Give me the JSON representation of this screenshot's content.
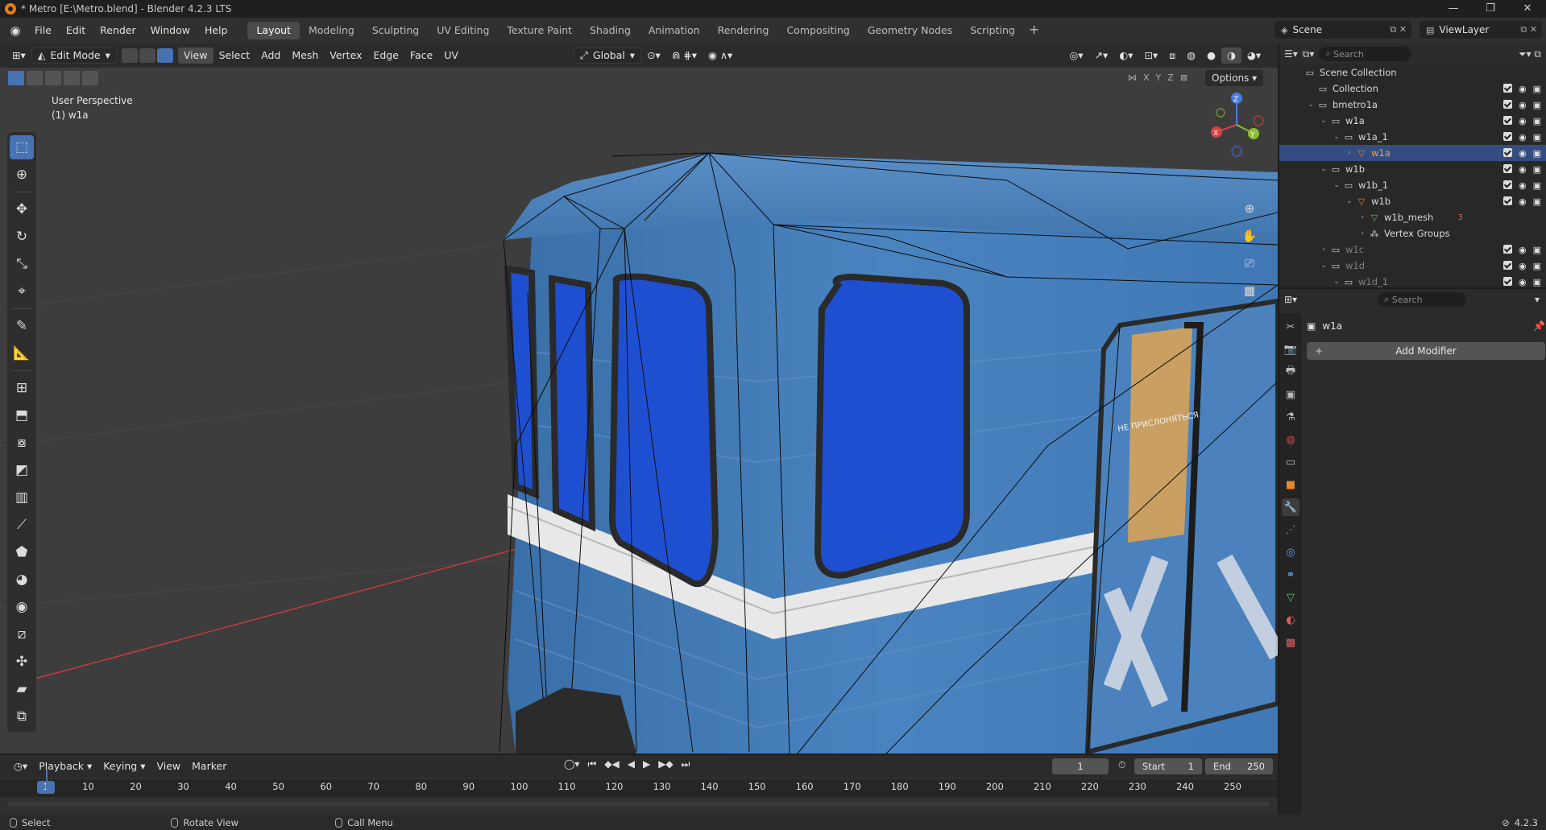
{
  "window": {
    "title": "* Metro [E:\\Metro.blend] - Blender 4.2.3 LTS",
    "controls": [
      "—",
      "❐",
      "✕"
    ]
  },
  "menu": [
    "File",
    "Edit",
    "Render",
    "Window",
    "Help"
  ],
  "workspaces": [
    "Layout",
    "Modeling",
    "Sculpting",
    "UV Editing",
    "Texture Paint",
    "Shading",
    "Animation",
    "Rendering",
    "Compositing",
    "Geometry Nodes",
    "Scripting"
  ],
  "active_workspace": "Layout",
  "scene": "Scene",
  "view_layer": "ViewLayer",
  "viewport": {
    "mode": "Edit Mode",
    "header_menus": [
      "View",
      "Select",
      "Add",
      "Mesh",
      "Vertex",
      "Edge",
      "Face",
      "UV"
    ],
    "orientation": "Global",
    "options": "Options",
    "axis_toggles": [
      "X",
      "Y",
      "Z"
    ],
    "view_name": "User Perspective",
    "object_label": "(1) w1a",
    "gizmo": {
      "x": "X",
      "y": "Y",
      "z": "Z"
    },
    "car_text": "НЕ ПРИСЛОНЯТЬСЯ"
  },
  "outliner": {
    "search_placeholder": "Search",
    "rows": [
      {
        "label": "Scene Collection",
        "indent": 0,
        "icon": "collection",
        "ctrls": false
      },
      {
        "label": "Collection",
        "indent": 1,
        "icon": "collection",
        "ctrls": true
      },
      {
        "label": "bmetro1a",
        "indent": 1,
        "icon": "collection",
        "ctrls": true,
        "twist": "⌄"
      },
      {
        "label": "w1a",
        "indent": 2,
        "icon": "collection",
        "ctrls": true,
        "twist": "⌄"
      },
      {
        "label": "w1a_1",
        "indent": 3,
        "icon": "collection",
        "ctrls": true,
        "twist": "⌄"
      },
      {
        "label": "w1a",
        "indent": 4,
        "icon": "mesh-object",
        "ctrls": true,
        "twist": "›",
        "selected": true
      },
      {
        "label": "w1b",
        "indent": 2,
        "icon": "collection",
        "ctrls": true,
        "twist": "⌄"
      },
      {
        "label": "w1b_1",
        "indent": 3,
        "icon": "collection",
        "ctrls": true,
        "twist": "⌄"
      },
      {
        "label": "w1b",
        "indent": 4,
        "icon": "mesh-object",
        "ctrls": true,
        "twist": "⌄"
      },
      {
        "label": "w1b_mesh",
        "indent": 5,
        "icon": "mesh-data",
        "ctrls": false,
        "twist": "›",
        "badge": "3"
      },
      {
        "label": "Vertex Groups",
        "indent": 5,
        "icon": "vertex-groups",
        "ctrls": false,
        "twist": "›"
      },
      {
        "label": "w1c",
        "indent": 2,
        "icon": "collection",
        "ctrls": true,
        "twist": "›",
        "dim": true
      },
      {
        "label": "w1d",
        "indent": 2,
        "icon": "collection",
        "ctrls": true,
        "twist": "⌄",
        "dim": true
      },
      {
        "label": "w1d_1",
        "indent": 3,
        "icon": "collection",
        "ctrls": true,
        "twist": "⌄",
        "dim": true
      }
    ]
  },
  "properties": {
    "search_placeholder": "Search",
    "object_name": "w1a",
    "add_modifier": "Add Modifier"
  },
  "timeline": {
    "menus": [
      "Playback",
      "Keying",
      "View",
      "Marker"
    ],
    "current_frame": "1",
    "start_label": "Start",
    "start": "1",
    "end_label": "End",
    "end": "250",
    "ticks": [
      "10",
      "20",
      "30",
      "40",
      "50",
      "60",
      "70",
      "80",
      "90",
      "100",
      "110",
      "120",
      "130",
      "140",
      "150",
      "160",
      "170",
      "180",
      "190",
      "200",
      "210",
      "220",
      "230",
      "240",
      "250"
    ]
  },
  "status": {
    "select": "Select",
    "rotate": "Rotate View",
    "call_menu": "Call Menu",
    "version": "4.2.3"
  },
  "colors": {
    "accent": "#4772b3",
    "train_body": "#3f78b5",
    "window_glass": "#1f4fd1",
    "stripe": "#e8e8e8",
    "x_axis": "#c93b3b"
  }
}
